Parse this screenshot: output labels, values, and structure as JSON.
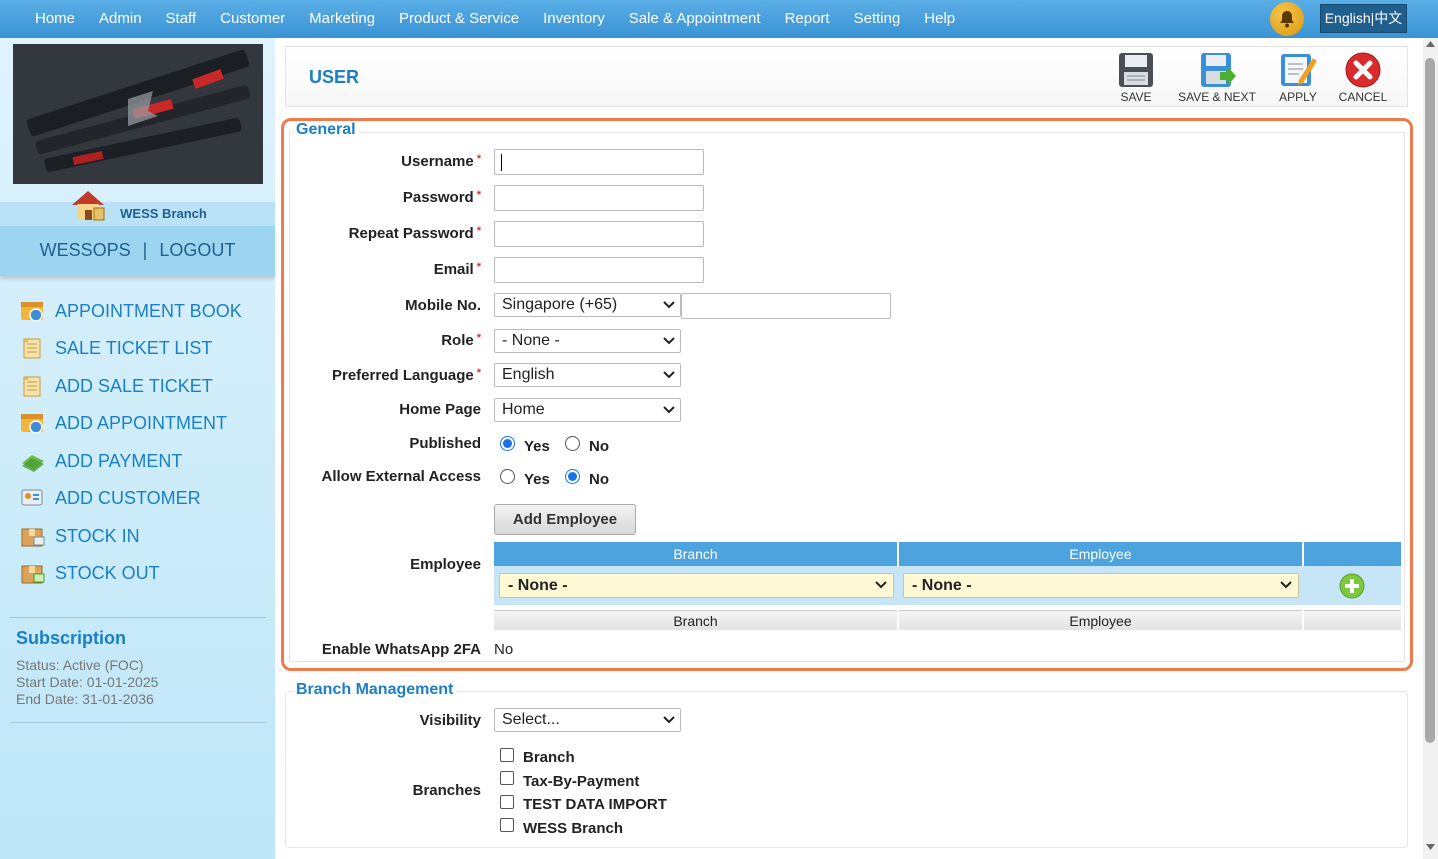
{
  "topnav": {
    "items": [
      "Home",
      "Admin",
      "Staff",
      "Customer",
      "Marketing",
      "Product & Service",
      "Inventory",
      "Sale & Appointment",
      "Report",
      "Setting",
      "Help"
    ],
    "language": "English|中文"
  },
  "sidebar": {
    "branch": "WESS Branch",
    "user": "WESSOPS",
    "separator": "|",
    "logout": "LOGOUT",
    "items": [
      {
        "label": "APPOINTMENT BOOK",
        "icon": "appointment-book-icon"
      },
      {
        "label": "SALE TICKET LIST",
        "icon": "sale-ticket-list-icon"
      },
      {
        "label": "ADD SALE TICKET",
        "icon": "add-sale-ticket-icon"
      },
      {
        "label": "ADD APPOINTMENT",
        "icon": "add-appointment-icon"
      },
      {
        "label": "ADD PAYMENT",
        "icon": "add-payment-icon"
      },
      {
        "label": "ADD CUSTOMER",
        "icon": "add-customer-icon"
      },
      {
        "label": "STOCK IN",
        "icon": "stock-in-icon"
      },
      {
        "label": "STOCK OUT",
        "icon": "stock-out-icon"
      }
    ],
    "subscription": {
      "title": "Subscription",
      "status": "Status: Active (FOC)",
      "start": "Start Date: 01-01-2025",
      "end": "End Date: 31-01-2036"
    }
  },
  "header": {
    "title": "USER",
    "buttons": {
      "save": "SAVE",
      "save_next": "SAVE & NEXT",
      "apply": "APPLY",
      "cancel": "CANCEL"
    }
  },
  "general": {
    "legend": "General",
    "username_label": "Username",
    "password_label": "Password",
    "repeat_password_label": "Repeat Password",
    "email_label": "Email",
    "mobile_label": "Mobile No.",
    "mobile_country": "Singapore (+65)",
    "role_label": "Role",
    "role_value": "- None -",
    "language_label": "Preferred Language",
    "language_value": "English",
    "homepage_label": "Home Page",
    "homepage_value": "Home",
    "published_label": "Published",
    "external_label": "Allow External Access",
    "yes": "Yes",
    "no": "No",
    "published_value": "Yes",
    "external_value": "No",
    "employee_label": "Employee",
    "add_employee": "Add Employee",
    "table_headers": [
      "Branch",
      "Employee"
    ],
    "branch_select": "- None -",
    "employee_select": "- None -",
    "table_footers": [
      "Branch",
      "Employee"
    ],
    "whatsapp_label": "Enable WhatsApp 2FA",
    "whatsapp_value": "No",
    "required_mark": "*"
  },
  "branch_management": {
    "legend": "Branch Management",
    "visibility_label": "Visibility",
    "visibility_value": "Select...",
    "branches_label": "Branches",
    "branches": [
      "Branch",
      "Tax-By-Payment",
      "TEST DATA IMPORT",
      "WESS Branch"
    ]
  },
  "colors": {
    "accent": "#1a7fc6",
    "nav": "#4aa3dd",
    "highlight_border": "#f07a4a"
  }
}
